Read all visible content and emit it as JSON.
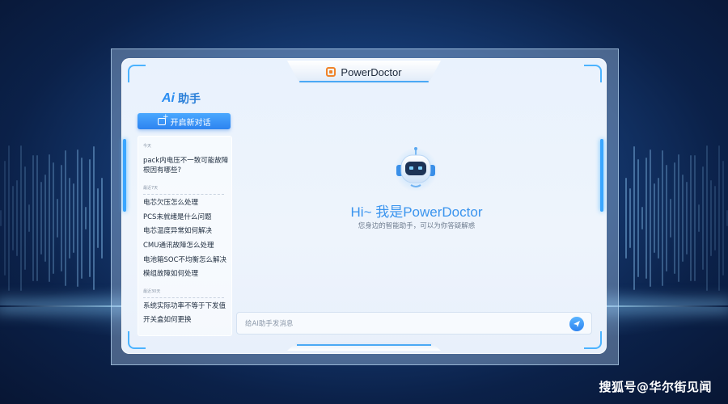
{
  "header": {
    "app_title": "PowerDoctor",
    "logo_icon": "power-doctor-logo-icon"
  },
  "sidebar": {
    "ai_mark": "Ai",
    "title": "助手",
    "new_chat_label": "开启新对话",
    "sections": [
      {
        "label": "今天",
        "items": [
          "pack内电压不一致可能故障根因有哪些?"
        ]
      },
      {
        "label": "最近7天",
        "items": [
          "电芯欠压怎么处理",
          "PCS未就绪是什么问题",
          "电芯温度异常如何解决",
          "CMU通讯故障怎么处理",
          "电池箱SOC不均衡怎么解决",
          "模组故障如何处理"
        ]
      },
      {
        "label": "最近30天",
        "items": [
          "系统实际功率不等于下发值",
          "开关盒如何更换"
        ]
      }
    ]
  },
  "main": {
    "greeting": "Hi~ 我是PowerDoctor",
    "subtitle": "您身边的智能助手，可以为你答疑解惑",
    "input_placeholder": "给AI助手发消息",
    "input_value": ""
  },
  "watermark": "搜狐号@华尔街见闻",
  "colors": {
    "accent": "#2d83f0",
    "greeting": "#3a94ee",
    "logo": "#f0832a"
  }
}
